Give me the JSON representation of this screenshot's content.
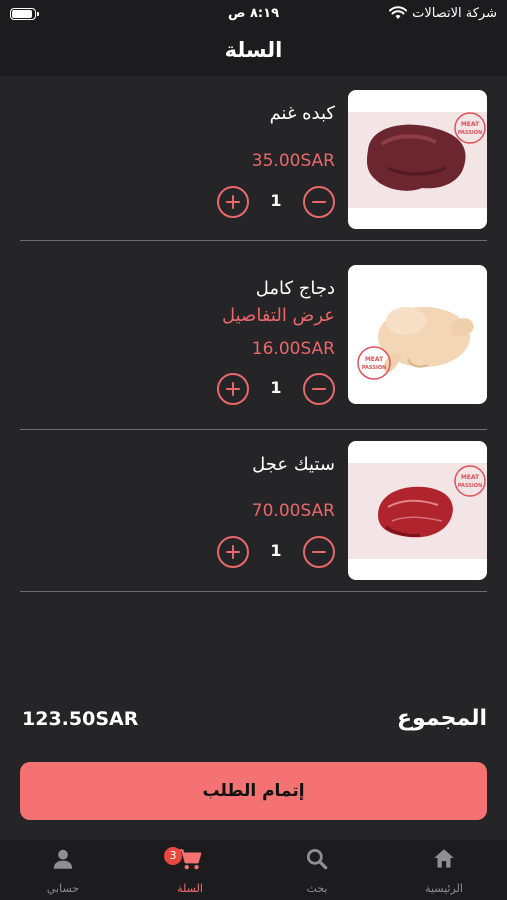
{
  "status_bar": {
    "carrier": "شركة الاتصالات",
    "time": "٨:١٩ ص"
  },
  "header": {
    "title": "السلة"
  },
  "cart": {
    "items": [
      {
        "name": "كبده غنم",
        "price": "35.00SAR",
        "quantity": "1",
        "image": "lamb-liver",
        "details_link": ""
      },
      {
        "name": "دجاج كامل",
        "price": "16.00SAR",
        "quantity": "1",
        "image": "whole-chicken",
        "details_link": "عرض التفاصيل"
      },
      {
        "name": "ستيك عجل",
        "price": "70.00SAR",
        "quantity": "1",
        "image": "veal-steak",
        "details_link": ""
      }
    ],
    "brand_stamp": "MEAT PASSION"
  },
  "summary": {
    "total_label": "المجموع",
    "total_value": "123.50SAR",
    "checkout_label": "إتمام الطلب"
  },
  "tab_bar": {
    "tabs": [
      {
        "label": "الرئيسية",
        "icon": "home-icon"
      },
      {
        "label": "بحث",
        "icon": "search-icon"
      },
      {
        "label": "السلة",
        "icon": "cart-icon",
        "active": true,
        "badge": "3"
      },
      {
        "label": "حسابي",
        "icon": "person-icon"
      }
    ]
  },
  "colors": {
    "background": "#252528",
    "bars": "#1c1c1e",
    "accent": "#f47272",
    "price": "#e8686a"
  }
}
